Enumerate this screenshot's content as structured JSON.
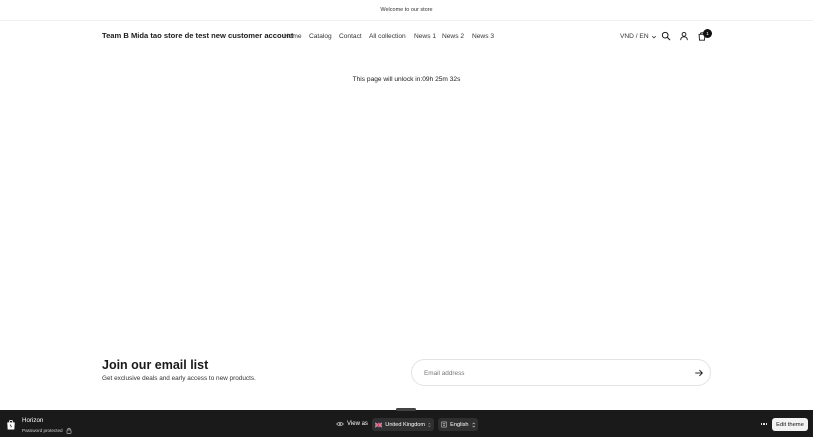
{
  "announcement": {
    "text": "Welcome to our store"
  },
  "header": {
    "store_name": "Team B Mida tao store de test new customer account",
    "nav": [
      "Home",
      "Catalog",
      "Contact",
      "All collection",
      "News 1",
      "News 2",
      "News 3"
    ],
    "locale": "VND / EN",
    "cart_count": "1",
    "icons": {
      "search": "search-icon",
      "account": "user-icon",
      "cart": "bag-icon",
      "locale_chevron": "chevron-down-icon"
    }
  },
  "countdown": {
    "text": "This page will unlock in:09h 25m 32s"
  },
  "newsletter": {
    "title": "Join our email list",
    "subtitle": "Get exclusive deals and early access to new products.",
    "placeholder": "Email address"
  },
  "preview_bar": {
    "theme_name": "Horizon",
    "status": "Password protected",
    "view_as_label": "View as",
    "country": "United Kingdom",
    "language": "English",
    "edit_label": "Edit theme"
  },
  "colors": {
    "background": "#ffffff",
    "text": "#1a1a1a",
    "preview_bar": "#1a1a1a",
    "pill": "#2f2f2f",
    "badge": "#111111"
  }
}
